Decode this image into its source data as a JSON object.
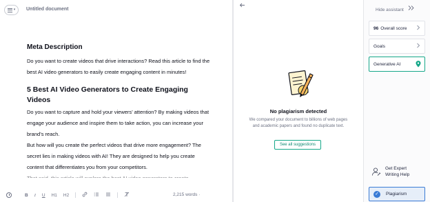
{
  "editor": {
    "document_title": "Untitled document",
    "content": {
      "heading_meta": "Meta Description",
      "meta_paragraph": "Do you want to create videos that drive interactions? Read this article to find the best AI video generators to easily create engaging content in minutes!",
      "heading_main": "5 Best AI Video Generators to Create Engaging Videos",
      "intro_paragraph": "Do you want to capture and hold your viewers’ attention? By making videos that engage your audience and inspire them to take action, you can increase your brand’s reach.",
      "second_paragraph": "But how will you create the perfect videos that drive more engagement? The secret lies in making videos with AI! They are designed to help you create content that differentiates you from your competitors.",
      "cut_line": "That said, this article will explore the best AI video generators to create"
    },
    "toolbar": {
      "bold": "B",
      "italic": "I",
      "underline": "U",
      "h1": "H1",
      "h2": "H2",
      "link": "🔗",
      "ordered_list": "≡",
      "unordered_list": "☰",
      "clear_format": "T̸"
    },
    "word_count": "2,215 words ·"
  },
  "plagiarism": {
    "back_icon": "arrow-left-icon",
    "title": "No plagiarism detected",
    "description": "We compared your document to billions of web pages and academic papers and found no duplicate text.",
    "button_label": "See all suggestions"
  },
  "assistant": {
    "hide_label": "Hide assistant",
    "overall_score_value": "96",
    "overall_score_label": "Overall score",
    "goals_label": "Goals",
    "generative_label": "Generative AI",
    "expert_label_line1": "Get Expert",
    "expert_label_line2": "Writing Help",
    "plagiarism_tab_label": "Plagiarism"
  },
  "colors": {
    "accent_green": "#15a789",
    "accent_blue": "#3a7bd5",
    "text_dark": "#0e101a",
    "text_muted": "#6d7283"
  }
}
